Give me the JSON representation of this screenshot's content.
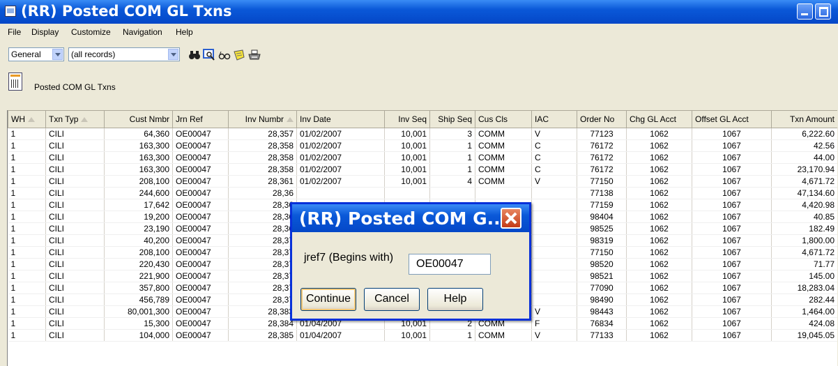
{
  "window": {
    "title": "(RR) Posted COM GL Txns",
    "icon": "app-window-icon",
    "colors": {
      "titlebar": "#0a58d8",
      "surface": "#ece9d8"
    }
  },
  "menu": [
    "File",
    "Display",
    "Customize",
    "Navigation",
    "Help"
  ],
  "toolbar": {
    "view_select": "General",
    "filter_select": "(all records)",
    "icons": [
      "binoculars-find-icon",
      "magnify-preview-icon",
      "glasses-view-icon",
      "sticky-note-icon",
      "printer-icon"
    ]
  },
  "report": {
    "label": "Posted COM GL Txns",
    "icon": "report-icon"
  },
  "grid": {
    "columns": [
      "WH",
      "Txn Typ",
      "Cust Nmbr",
      "Jrn Ref",
      "Inv Numbr",
      "Inv Date",
      "Inv Seq",
      "Ship Seq",
      "Cus Cls",
      "IAC",
      "Order No",
      "Chg GL Acct",
      "Offset GL Acct",
      "Txn Amount"
    ],
    "rows": [
      [
        "1",
        "CILI",
        "64,360",
        "OE00047",
        "28,357",
        "01/02/2007",
        "10,001",
        "3",
        "COMM",
        "V",
        "77123",
        "1062",
        "1067",
        "6,222.60"
      ],
      [
        "1",
        "CILI",
        "163,300",
        "OE00047",
        "28,358",
        "01/02/2007",
        "10,001",
        "1",
        "COMM",
        "C",
        "76172",
        "1062",
        "1067",
        "42.56"
      ],
      [
        "1",
        "CILI",
        "163,300",
        "OE00047",
        "28,358",
        "01/02/2007",
        "10,001",
        "1",
        "COMM",
        "C",
        "76172",
        "1062",
        "1067",
        "44.00"
      ],
      [
        "1",
        "CILI",
        "163,300",
        "OE00047",
        "28,358",
        "01/02/2007",
        "10,001",
        "1",
        "COMM",
        "C",
        "76172",
        "1062",
        "1067",
        "23,170.94"
      ],
      [
        "1",
        "CILI",
        "208,100",
        "OE00047",
        "28,361",
        "01/02/2007",
        "10,001",
        "4",
        "COMM",
        "V",
        "77150",
        "1062",
        "1067",
        "4,671.72"
      ],
      [
        "1",
        "CILI",
        "244,600",
        "OE00047",
        "28,36",
        "",
        "",
        "",
        "",
        "",
        "77138",
        "1062",
        "1067",
        "47,134.60"
      ],
      [
        "1",
        "CILI",
        "17,642",
        "OE00047",
        "28,36",
        "",
        "",
        "",
        "",
        "",
        "77159",
        "1062",
        "1067",
        "4,420.98"
      ],
      [
        "1",
        "CILI",
        "19,200",
        "OE00047",
        "28,36",
        "",
        "",
        "",
        "",
        "",
        "98404",
        "1062",
        "1067",
        "40.85"
      ],
      [
        "1",
        "CILI",
        "23,190",
        "OE00047",
        "28,36",
        "",
        "",
        "",
        "",
        "",
        "98525",
        "1062",
        "1067",
        "182.49"
      ],
      [
        "1",
        "CILI",
        "40,200",
        "OE00047",
        "28,37",
        "",
        "",
        "",
        "",
        "",
        "98319",
        "1062",
        "1067",
        "1,800.00"
      ],
      [
        "1",
        "CILI",
        "208,100",
        "OE00047",
        "28,37",
        "",
        "",
        "",
        "",
        "",
        "77150",
        "1062",
        "1067",
        "4,671.72"
      ],
      [
        "1",
        "CILI",
        "220,430",
        "OE00047",
        "28,37",
        "",
        "",
        "",
        "",
        "",
        "98520",
        "1062",
        "1067",
        "71.77"
      ],
      [
        "1",
        "CILI",
        "221,900",
        "OE00047",
        "28,37",
        "",
        "",
        "",
        "",
        "",
        "98521",
        "1062",
        "1067",
        "145.00"
      ],
      [
        "1",
        "CILI",
        "357,800",
        "OE00047",
        "28,37",
        "",
        "",
        "",
        "",
        "",
        "77090",
        "1062",
        "1067",
        "18,283.04"
      ],
      [
        "1",
        "CILI",
        "456,789",
        "OE00047",
        "28,37",
        "",
        "",
        "",
        "",
        "",
        "98490",
        "1062",
        "1067",
        "282.44"
      ],
      [
        "1",
        "CILI",
        "80,001,300",
        "OE00047",
        "28,383",
        "01/03/2007",
        "10,001",
        "1",
        "COMM",
        "V",
        "98443",
        "1062",
        "1067",
        "1,464.00"
      ],
      [
        "1",
        "CILI",
        "15,300",
        "OE00047",
        "28,384",
        "01/04/2007",
        "10,001",
        "2",
        "COMM",
        "F",
        "76834",
        "1062",
        "1067",
        "424.08"
      ],
      [
        "1",
        "CILI",
        "104,000",
        "OE00047",
        "28,385",
        "01/04/2007",
        "10,001",
        "1",
        "COMM",
        "V",
        "77133",
        "1062",
        "1067",
        "19,045.05"
      ]
    ]
  },
  "dialog": {
    "title": "(RR) Posted COM G...",
    "field_label": "jref7 (Begins with)",
    "field_value": "OE00047",
    "buttons": {
      "continue": "Continue",
      "cancel": "Cancel",
      "help": "Help"
    }
  }
}
